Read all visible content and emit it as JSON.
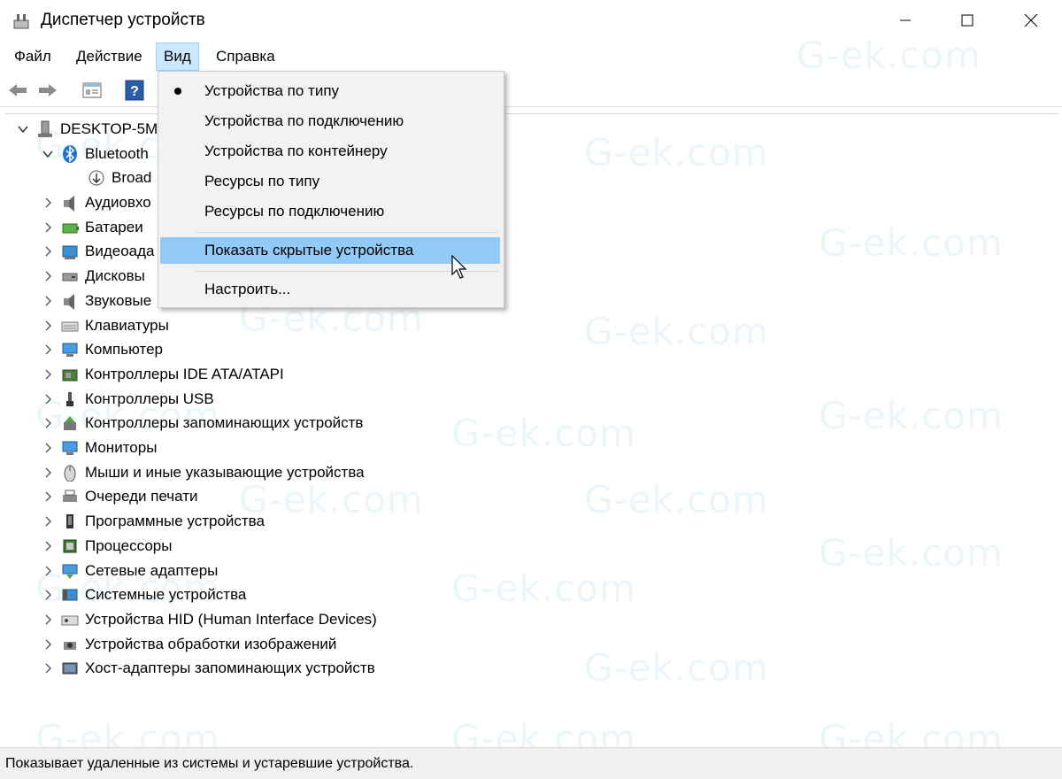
{
  "window": {
    "title": "Диспетчер устройств"
  },
  "menubar": {
    "items": [
      "Файл",
      "Действие",
      "Вид",
      "Справка"
    ]
  },
  "tree": {
    "root": "DESKTOP-5M",
    "bluetooth": "Bluetooth",
    "bluetooth_child": "Broad",
    "categories": [
      "Аудиовхо",
      "Батареи",
      "Видеоада",
      "Дисковы",
      "Звуковые",
      "Клавиатуры",
      "Компьютер",
      "Контроллеры IDE ATA/ATAPI",
      "Контроллеры USB",
      "Контроллеры запоминающих устройств",
      "Мониторы",
      "Мыши и иные указывающие устройства",
      "Очереди печати",
      "Программные устройства",
      "Процессоры",
      "Сетевые адаптеры",
      "Системные устройства",
      "Устройства HID (Human Interface Devices)",
      "Устройства обработки изображений",
      "Хост-адаптеры запоминающих устройств"
    ]
  },
  "view_menu": {
    "items": [
      "Устройства по типу",
      "Устройства по подключению",
      "Устройства по контейнеру",
      "Ресурсы по типу",
      "Ресурсы по подключению",
      "Показать скрытые устройства",
      "Настроить..."
    ]
  },
  "status": {
    "text": "Показывает удаленные из системы и устаревшие устройства."
  },
  "watermark": {
    "text": "G-ek.com"
  },
  "colors": {
    "menu_highlight": "#91c9f7",
    "menu_active": "#cce8ff",
    "accent_blue": "#1e73d6"
  }
}
